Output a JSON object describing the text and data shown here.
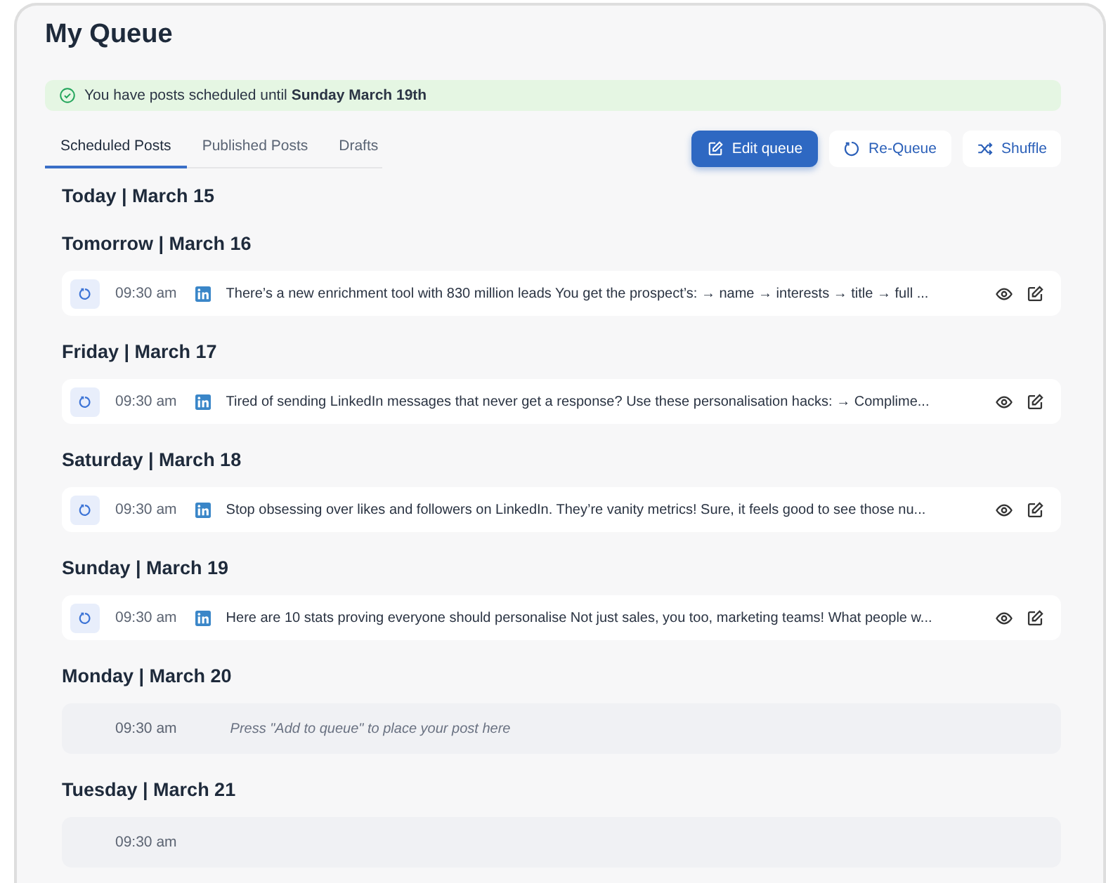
{
  "title": "My Queue",
  "alert": {
    "text": "You have posts scheduled until **Sunday March 19th**"
  },
  "tabs": [
    {
      "label": "Scheduled Posts",
      "selected": true
    },
    {
      "label": "Published Posts",
      "selected": false
    },
    {
      "label": "Drafts",
      "selected": false
    }
  ],
  "actions": [
    {
      "label": "Edit queue",
      "kind": "primary"
    },
    {
      "label": "Re-Queue",
      "kind": "secondary"
    },
    {
      "label": "Shuffle",
      "kind": "secondary"
    }
  ],
  "days": [
    {
      "heading": "Today | March 15"
    },
    {
      "heading": "Tomorrow | March 16",
      "slots": [
        {
          "kind": "post",
          "time": "09:30 am",
          "text": "There’s a new enrichment tool with 830 million leads You get the prospect’s: → name → interests → title → full ..."
        }
      ]
    },
    {
      "heading": "Friday | March 17",
      "slots": [
        {
          "kind": "post",
          "time": "09:30 am",
          "text": "Tired of sending LinkedIn messages that never get a response? Use these personalisation hacks: → Complime..."
        }
      ]
    },
    {
      "heading": "Saturday | March 18",
      "slots": [
        {
          "kind": "post",
          "time": "09:30 am",
          "text": "Stop obsessing over likes and followers on LinkedIn. They’re vanity metrics! Sure, it feels good to see those nu..."
        }
      ]
    },
    {
      "heading": "Sunday | March 19",
      "slots": [
        {
          "kind": "post",
          "time": "09:30 am",
          "text": "Here are 10 stats proving everyone should personalise Not just sales, you too, marketing teams! What people w..."
        }
      ]
    },
    {
      "heading": "Monday | March 20",
      "slots": [
        {
          "kind": "empty",
          "time": "09:30 am",
          "text": "Press \"Add to queue\" to place your post here"
        }
      ]
    },
    {
      "heading": "Tuesday | March 21",
      "slots": [
        {
          "kind": "empty",
          "time": "09:30 am"
        }
      ]
    }
  ]
}
